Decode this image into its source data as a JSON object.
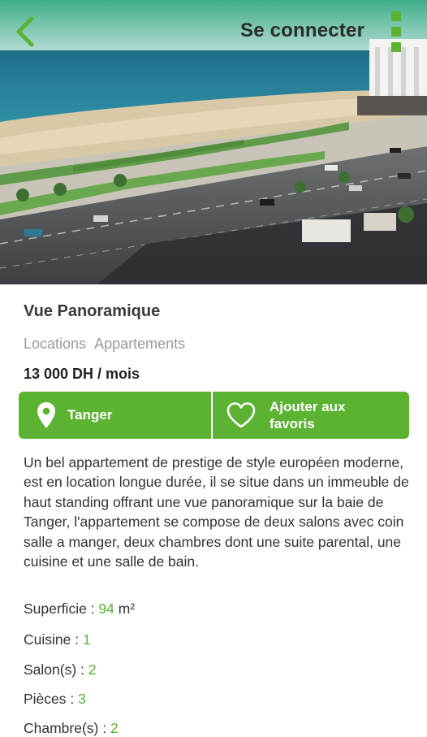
{
  "header": {
    "login_label": "Se connecter",
    "back_icon": "chevron-left-icon",
    "menu_icon": "vertical-dots-icon"
  },
  "listing": {
    "title": "Vue Panoramique",
    "categories": [
      "Locations",
      "Appartements"
    ],
    "price": "13 000 DH / mois",
    "city": "Tanger",
    "favorite_label": "Ajouter aux favoris",
    "description": "Un bel appartement de prestige de style européen moderne, est en location longue durée, il se situe dans un immeuble de haut standing offrant une vue panoramique sur la baie de Tanger, l'appartement se compose de deux salons avec coin salle a manger, deux chambres dont une suite parental, une cuisine et une salle de bain.",
    "specs": [
      {
        "label": "Superficie : ",
        "value": "94",
        "unit": " m²"
      },
      {
        "label": "Cuisine : ",
        "value": "1",
        "unit": ""
      },
      {
        "label": "Salon(s) : ",
        "value": "2",
        "unit": ""
      },
      {
        "label": "Pièces : ",
        "value": "3",
        "unit": ""
      },
      {
        "label": "Chambre(s) : ",
        "value": "2",
        "unit": ""
      }
    ]
  },
  "colors": {
    "accent": "#5cb332",
    "text": "#333333",
    "muted": "#9a9a9a"
  }
}
